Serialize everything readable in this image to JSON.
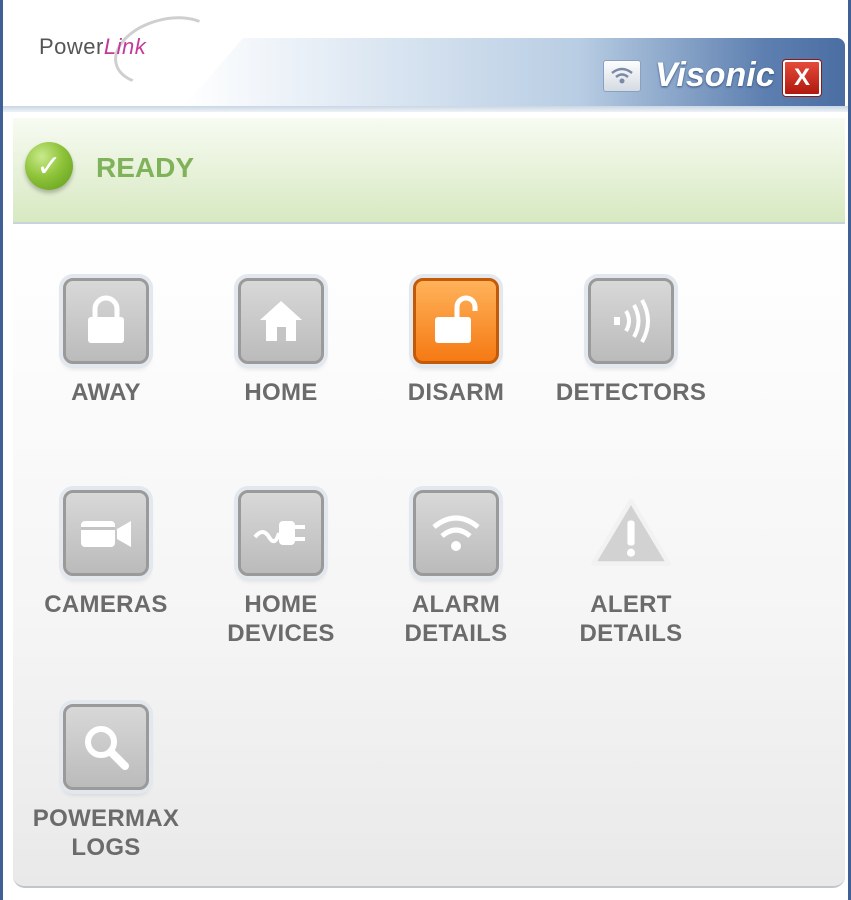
{
  "header": {
    "logo_text_1": "Power",
    "logo_text_2": "Link",
    "brand": "Visonic",
    "close_label": "X"
  },
  "status": {
    "label": "READY"
  },
  "tiles": [
    {
      "line1": "AWAY",
      "line2": "",
      "icon": "lock-icon"
    },
    {
      "line1": "HOME",
      "line2": "",
      "icon": "house-icon"
    },
    {
      "line1": "DISARM",
      "line2": "",
      "icon": "unlock-icon"
    },
    {
      "line1": "DETECTORS",
      "line2": "",
      "icon": "sensor-waves-icon"
    },
    {
      "line1": "CAMERAS",
      "line2": "",
      "icon": "video-camera-icon"
    },
    {
      "line1": "HOME",
      "line2": "DEVICES",
      "icon": "plug-icon"
    },
    {
      "line1": "ALARM",
      "line2": "DETAILS",
      "icon": "wifi-icon"
    },
    {
      "line1": "ALERT",
      "line2": "DETAILS",
      "icon": "warning-triangle-icon"
    },
    {
      "line1": "POWERMAX",
      "line2": "LOGS",
      "icon": "magnifier-icon"
    }
  ],
  "colors": {
    "accent_active": "#f57a14",
    "status_green": "#7fb25a",
    "frame_blue": "#3f5f95"
  }
}
